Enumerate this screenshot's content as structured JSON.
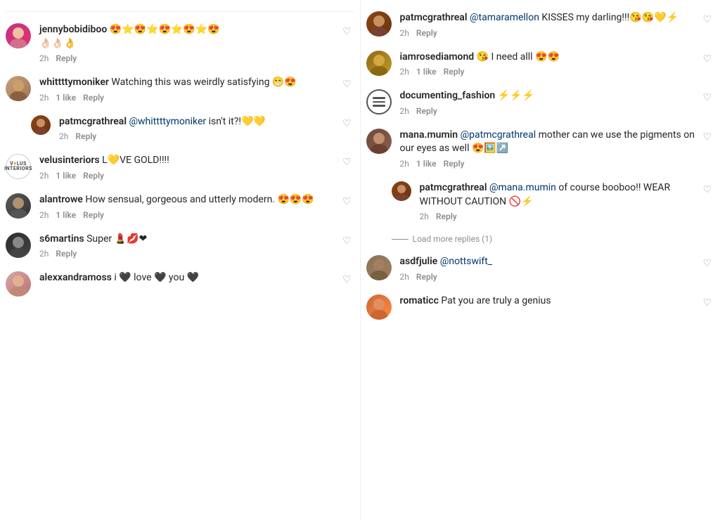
{
  "left_column": {
    "comments": [
      {
        "id": "jenny",
        "username": "jennybobidiboo",
        "text": "😍☆😍☆😍☆😍☆😍",
        "text2": "👌🏻👌🏻👌",
        "time": "2h",
        "likes": null,
        "reply_label": "Reply"
      },
      {
        "id": "whitt",
        "username": "whittttymoniker",
        "text": "Watching this was weirdly satisfying 😁😍",
        "time": "2h",
        "likes": "1 like",
        "reply_label": "Reply"
      },
      {
        "id": "pat1",
        "username": "patmcgrathreal",
        "mention": "@whittttymoniker",
        "text": "isn't it?!💛💛",
        "time": "2h",
        "likes": null,
        "reply_label": "Reply",
        "indented": true
      },
      {
        "id": "velus",
        "username": "velusinteriors",
        "text": "L💛VE GOLD!!!!",
        "time": "2h",
        "likes": "1 like",
        "reply_label": "Reply",
        "logo": true
      },
      {
        "id": "alan",
        "username": "alantrowe",
        "text": "How sensual, gorgeous and utterly modern. 😍😍😍",
        "time": "2h",
        "likes": "1 like",
        "reply_label": "Reply"
      },
      {
        "id": "s6",
        "username": "s6martins",
        "text": "Super 💄💋❤",
        "time": "2h",
        "likes": null,
        "reply_label": "Reply"
      },
      {
        "id": "alexx",
        "username": "alexxandramoss",
        "text": "i 🖤 love 🖤 you 🖤",
        "time": "2h",
        "likes": null,
        "reply_label": "Reply"
      }
    ]
  },
  "right_column": {
    "comments": [
      {
        "id": "tamaramellon",
        "username": "patmcgrathreal",
        "mention": "@tamaramellon",
        "text": "KISSES my darling!!!😘😘💛⚡",
        "time": "2h",
        "likes": null,
        "reply_label": "Reply"
      },
      {
        "id": "iamrose",
        "username": "iamrosediamond",
        "text": "😘 I need alll 😍😍",
        "time": "2h",
        "likes": "1 like",
        "reply_label": "Reply"
      },
      {
        "id": "docfash",
        "username": "documenting_fashion",
        "text": "⚡⚡⚡",
        "time": "2h",
        "likes": null,
        "reply_label": "Reply",
        "doc_avatar": true
      },
      {
        "id": "mana",
        "username": "mana.mumin",
        "mention": "@patmcgrathreal",
        "text": "mother can we use the pigments on our eyes as well 😍🖼️↗️",
        "time": "2h",
        "likes": "1 like",
        "reply_label": "Reply"
      },
      {
        "id": "pat2",
        "username": "patmcgrathreal",
        "mention": "@mana.mumin",
        "text": "of course booboo!! WEAR WITHOUT CAUTION 🚫⚡",
        "time": "2h",
        "likes": null,
        "reply_label": "Reply",
        "indented": true
      },
      {
        "id": "loadmore",
        "label": "Load more replies (1)"
      },
      {
        "id": "asdfjulie",
        "username": "asdfjulie",
        "mention": "@nottswift_",
        "text": "",
        "time": "2h",
        "likes": null,
        "reply_label": "Reply"
      },
      {
        "id": "romaticc",
        "username": "romaticc",
        "text": "Pat you are truly a genius",
        "time": "2h",
        "likes": null,
        "reply_label": "Reply"
      }
    ]
  }
}
